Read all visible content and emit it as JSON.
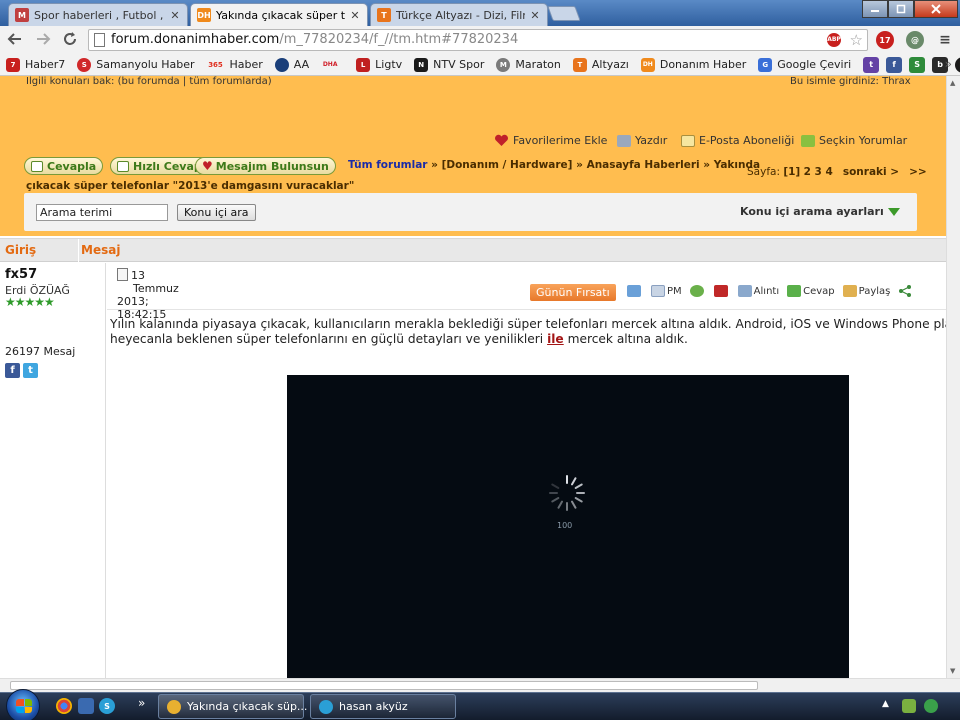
{
  "browser": {
    "tabs": [
      {
        "label": "Spor haberleri , Futbol , fe",
        "favicon": "M",
        "favcolor": "#c04040"
      },
      {
        "label": "Yakında çıkacak süper tele",
        "favicon": "DH",
        "favcolor": "#f08a1c"
      },
      {
        "label": "Türkçe Altyazı - Dizi, Film,",
        "favicon": "T",
        "favcolor": "#e8741c"
      }
    ],
    "tab_close": "✕",
    "address": {
      "domain": "forum.donanimhaber.com",
      "path": "/m_77820234/f_//tm.htm#77820234"
    },
    "adblock_label": "ABP",
    "notification_count": "17",
    "bookmarks": [
      {
        "label": "Haber7",
        "color": "#c8201e",
        "glyph": "7"
      },
      {
        "label": "Samanyolu Haber",
        "color": "#d0282a",
        "glyph": "S"
      },
      {
        "label": "Haber",
        "color": "#e03020",
        "glyph": "365"
      },
      {
        "label": "AA",
        "color": "#1a3f7a",
        "glyph": "AA"
      },
      {
        "label": "",
        "color": "#d0202a",
        "glyph": "DHA"
      },
      {
        "label": "Ligtv",
        "color": "#c02020",
        "glyph": "L"
      },
      {
        "label": "NTV Spor",
        "color": "#1a1a1a",
        "glyph": "N"
      },
      {
        "label": "Maraton",
        "color": "#7a7a7a",
        "glyph": "M"
      },
      {
        "label": "Altyazı",
        "color": "#e8741c",
        "glyph": "T"
      },
      {
        "label": "Donanım Haber",
        "color": "#f08a1c",
        "glyph": "DH"
      },
      {
        "label": "Google Çeviri",
        "color": "#3a6fd8",
        "glyph": "G"
      }
    ],
    "bookmark_icons": [
      {
        "name": "twitch-icon",
        "color": "#6441a5",
        "glyph": "t"
      },
      {
        "name": "facebook-icon",
        "color": "#3b5998",
        "glyph": "f"
      },
      {
        "name": "s-icon",
        "color": "#2e8b3a",
        "glyph": "S"
      },
      {
        "name": "b-icon",
        "color": "#2a2a2a",
        "glyph": "b"
      },
      {
        "name": "m-icon",
        "color": "#1a1a1a",
        "glyph": "M"
      },
      {
        "name": "orange-grid-icon",
        "color": "#f08a1c",
        "glyph": "#"
      }
    ],
    "bookmarks_more": "»"
  },
  "forum": {
    "top_links": "İlgili konuları bak: (bu forumda | tüm forumlarda)",
    "top_right": "Bu isimle girdiniz: Thrax",
    "actions": [
      {
        "label": "Favorilerime Ekle",
        "icon": "heart-icon",
        "color": "#c0202a"
      },
      {
        "label": "Yazdır",
        "icon": "printer-icon",
        "color": "#7a8aa0"
      },
      {
        "label": "E-Posta Aboneliği",
        "icon": "mail-icon",
        "color": "#e0c060"
      },
      {
        "label": "Seçkin Yorumlar",
        "icon": "handshake-icon",
        "color": "#6aa030"
      }
    ],
    "buttons": {
      "reply": "Cevapla",
      "quick_reply": "Hızlı Cevap",
      "find_my_message": "Mesajım Bulunsun"
    },
    "breadcrumb": {
      "all_forums": "Tüm forumlar",
      "path": "» [Donanım / Hardware] » Anasayfa Haberleri » Yakında",
      "title_line": "çıkacak süper telefonlar \"2013'e damgasını vuracaklar\""
    },
    "pager": {
      "label": "Sayfa:",
      "current": "[1]",
      "pages": "2 3 4",
      "next": "sonraki >",
      "last": ">>"
    },
    "search": {
      "value": "Arama terimi",
      "button": "Konu içi ara",
      "settings": "Konu içi arama ayarları"
    },
    "columns": {
      "login": "Giriş",
      "message": "Mesaj"
    },
    "post": {
      "username": "fx57",
      "rank": "Erdi ÖZÜAĞ",
      "stars": "★★★★★",
      "message_count": "26197 Mesaj",
      "date_line1": "13",
      "date_line2": "Temmuz",
      "date_line3": "2013;",
      "date_line4": "18:42:15",
      "deal_button": "Günün Fırsatı",
      "actions": [
        {
          "label": "",
          "icon": "envelope-icon",
          "color": "#4a86c8"
        },
        {
          "label": "PM",
          "icon": "pm-icon",
          "color": "#8aa0c0"
        },
        {
          "label": "",
          "icon": "user-add-icon",
          "color": "#4a9a3a"
        },
        {
          "label": "",
          "icon": "report-hand-icon",
          "color": "#c02828"
        },
        {
          "label": "Alıntı",
          "icon": "quote-icon",
          "color": "#6a8ab0"
        },
        {
          "label": "Cevap",
          "icon": "reply-icon",
          "color": "#3a9a3a"
        },
        {
          "label": "Paylaş",
          "icon": "share-icon",
          "color": "#e0a040"
        },
        {
          "label": "",
          "icon": "share-network-icon",
          "color": "#3a8a3a"
        }
      ],
      "body_line1": "Yılın kalanında piyasaya çıkacak, kullanıcıların merakla beklediği süper telefonları mercek altına aldık. Android, iOS ve Windows Phone pla",
      "body_line2_a": "heyecanla beklenen süper telefonlarını en güçlü detayları ve yenilikleri ",
      "body_line2_kw": "ile",
      "body_line2_b": " mercek altına aldık.",
      "video_label": "100"
    }
  },
  "taskbar": {
    "more": "»",
    "windows": [
      {
        "label": "Yakında çıkacak süp...",
        "color": "#e8b030"
      },
      {
        "label": "hasan akyüz",
        "color": "#2a9fd6"
      }
    ]
  }
}
